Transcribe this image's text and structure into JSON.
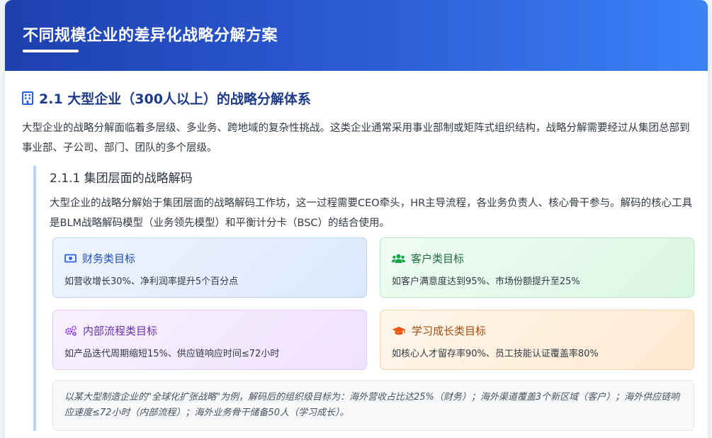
{
  "header": {
    "title": "不同规模企业的差异化战略分解方案"
  },
  "section": {
    "icon": "building-icon",
    "title": "2.1 大型企业（300人以上）的战略分解体系",
    "paragraph": "大型企业的战略分解面临着多层级、多业务、跨地域的复杂性挑战。这类企业通常采用事业部制或矩阵式组织结构，战略分解需要经过从集团总部到事业部、子公司、部门、团队的多个层级。"
  },
  "subsection": {
    "title": "2.1.1 集团层面的战略解码",
    "paragraph": "大型企业的战略分解始于集团层面的战略解码工作坊，这一过程需要CEO牵头，HR主导流程，各业务负责人、核心骨干参与。解码的核心工具是BLM战略解码模型（业务领先模型）和平衡计分卡（BSC）的结合使用。",
    "cards": [
      {
        "icon": "money-bill-icon",
        "title": "财务类目标",
        "text": "如营收增长30%、净利润率提升5个百分点",
        "color": "#2563eb"
      },
      {
        "icon": "users-icon",
        "title": "客户类目标",
        "text": "如客户满意度达到95%、市场份额提升至25%",
        "color": "#16a34a"
      },
      {
        "icon": "cogs-icon",
        "title": "内部流程类目标",
        "text": "如产品迭代周期缩短15%、供应链响应时间≤72小时",
        "color": "#9333ea"
      },
      {
        "icon": "graduation-cap-icon",
        "title": "学习成长类目标",
        "text": "如核心人才留存率90%、员工技能认证覆盖率80%",
        "color": "#ea580c"
      }
    ],
    "example": "以某大型制造企业的\"全球化扩张战略\"为例，解码后的组织级目标为：海外营收占比达25%（财务）；海外渠道覆盖3个新区域（客户）；海外供应链响应速度≤72小时（内部流程）；海外业务骨干储备50人（学习成长）。"
  }
}
